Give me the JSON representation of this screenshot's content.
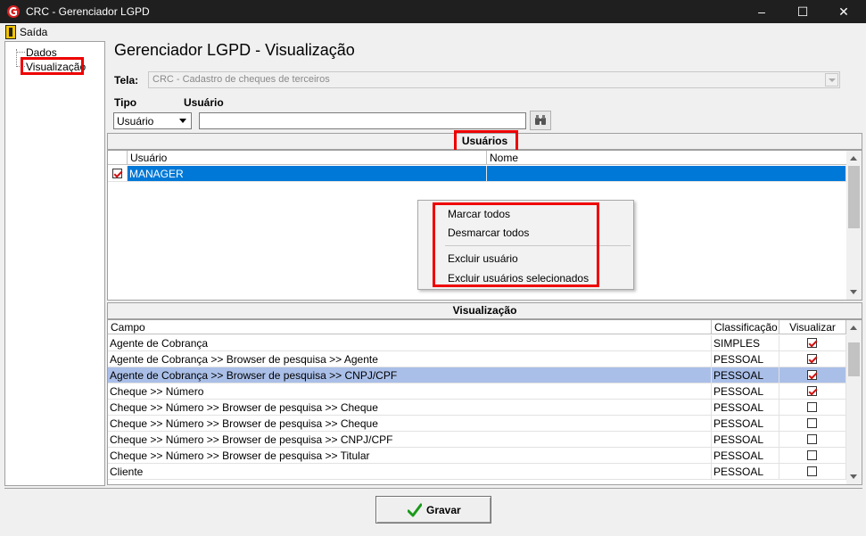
{
  "window": {
    "title": "CRC - Gerenciador LGPD",
    "minimize": "–",
    "maximize": "☐",
    "close": "✕"
  },
  "menu": {
    "exit": "Saída"
  },
  "tree": {
    "items": [
      "Dados",
      "Visualização"
    ]
  },
  "page": {
    "title": "Gerenciador LGPD - Visualização"
  },
  "screen": {
    "label": "Tela:",
    "value": "CRC - Cadastro de cheques de terceiros"
  },
  "filters": {
    "type_label": "Tipo",
    "type_value": "Usuário",
    "user_label": "Usuário",
    "user_value": ""
  },
  "users": {
    "header": "Usuários",
    "columns": [
      "Usuário",
      "Nome"
    ],
    "rows": [
      {
        "user": "MANAGER",
        "name": "",
        "checked": true
      }
    ]
  },
  "context_menu": {
    "items": [
      "Marcar todos",
      "Desmarcar todos",
      "Excluir usuário",
      "Excluir usuários selecionados"
    ]
  },
  "visualization": {
    "header": "Visualização",
    "columns": [
      "Campo",
      "Classificação",
      "Visualizar"
    ],
    "rows": [
      {
        "field": "Agente de Cobrança",
        "class": "SIMPLES",
        "view": true
      },
      {
        "field": "Agente de Cobrança >> Browser de pesquisa >> Agente",
        "class": "PESSOAL",
        "view": true
      },
      {
        "field": "Agente de Cobrança >> Browser de pesquisa >> CNPJ/CPF",
        "class": "PESSOAL",
        "view": true
      },
      {
        "field": "Cheque >> Número",
        "class": "PESSOAL",
        "view": true
      },
      {
        "field": "Cheque >> Número >> Browser de pesquisa >> Cheque",
        "class": "PESSOAL",
        "view": false
      },
      {
        "field": "Cheque >> Número >> Browser de pesquisa >> Cheque",
        "class": "PESSOAL",
        "view": false
      },
      {
        "field": "Cheque >> Número >> Browser de pesquisa >> CNPJ/CPF",
        "class": "PESSOAL",
        "view": false
      },
      {
        "field": "Cheque >> Número >> Browser de pesquisa >> Titular",
        "class": "PESSOAL",
        "view": false
      },
      {
        "field": "Cliente",
        "class": "PESSOAL",
        "view": false
      }
    ]
  },
  "actions": {
    "save": "Gravar"
  },
  "colors": {
    "selection": "#0078d7",
    "row_highlight": "#aabfe8",
    "annotation": "#e00000"
  }
}
